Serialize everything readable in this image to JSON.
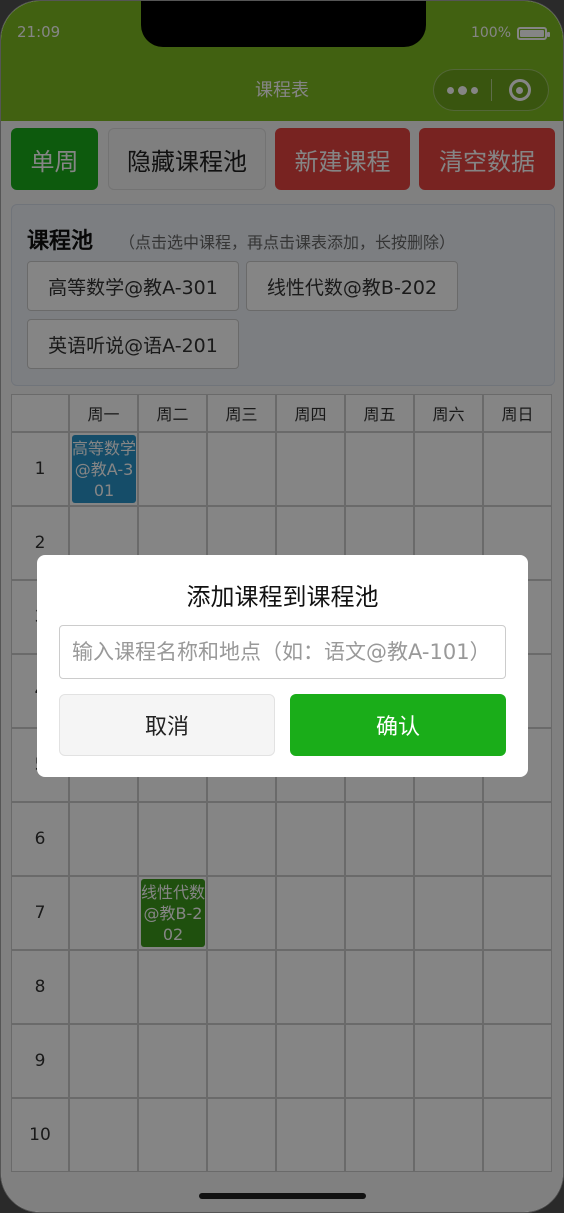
{
  "status": {
    "time": "21:09",
    "battery": "100%"
  },
  "nav": {
    "title": "课程表"
  },
  "toolbar": {
    "week_label": "单周",
    "hide_pool_label": "隐藏课程池",
    "new_course_label": "新建课程",
    "clear_label": "清空数据"
  },
  "pool": {
    "title": "课程池",
    "hint": "（点击选中课程，再点击课表添加，长按删除）",
    "items": [
      "高等数学@教A-301",
      "线性代数@教B-202",
      "英语听说@语A-201"
    ]
  },
  "schedule": {
    "days": [
      "周一",
      "周二",
      "周三",
      "周四",
      "周五",
      "周六",
      "周日"
    ],
    "periods": [
      "1",
      "2",
      "3",
      "4",
      "5",
      "6",
      "7",
      "8",
      "9",
      "10"
    ],
    "courses": [
      {
        "period": 1,
        "day": 1,
        "label": "高等数学@教A-301",
        "color": "#2a94c9"
      },
      {
        "period": 7,
        "day": 2,
        "label": "线性代数@教B-202",
        "color": "#3c9a1c"
      }
    ]
  },
  "dialog": {
    "title": "添加课程到课程池",
    "input_value": "",
    "input_placeholder": "输入课程名称和地点（如：语文@教A-101）",
    "cancel_label": "取消",
    "confirm_label": "确认"
  },
  "colors": {
    "nav_green": "#7dbb22",
    "button_green": "#1aad19",
    "button_red": "#e64340"
  }
}
